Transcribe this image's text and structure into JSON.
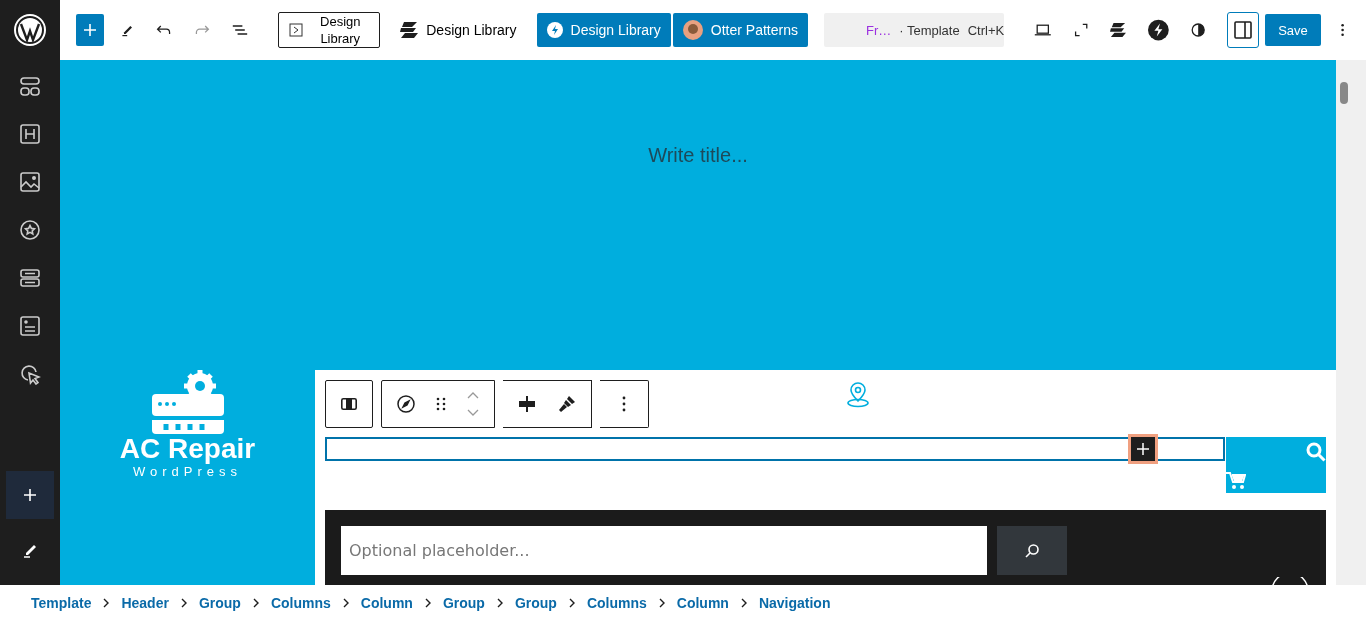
{
  "top_bar": {
    "buttons": [
      {
        "kind": "framed",
        "label": "Design Library"
      },
      {
        "kind": "plain",
        "label": "Design Library"
      },
      {
        "kind": "primary",
        "label": "Design Library"
      },
      {
        "kind": "avatar",
        "label": "Otter Patterns"
      }
    ],
    "command": {
      "title": "Fr…",
      "type": "· Template",
      "shortcut": "Ctrl+K"
    },
    "save": "Save"
  },
  "canvas": {
    "title_placeholder": "Write title...",
    "logo": {
      "name": "AC Repair",
      "tagline": "WordPress"
    },
    "search": {
      "placeholder": "Optional placeholder..."
    }
  },
  "breadcrumbs": [
    "Template",
    "Header",
    "Group",
    "Columns",
    "Column",
    "Group",
    "Group",
    "Columns",
    "Column",
    "Navigation"
  ]
}
